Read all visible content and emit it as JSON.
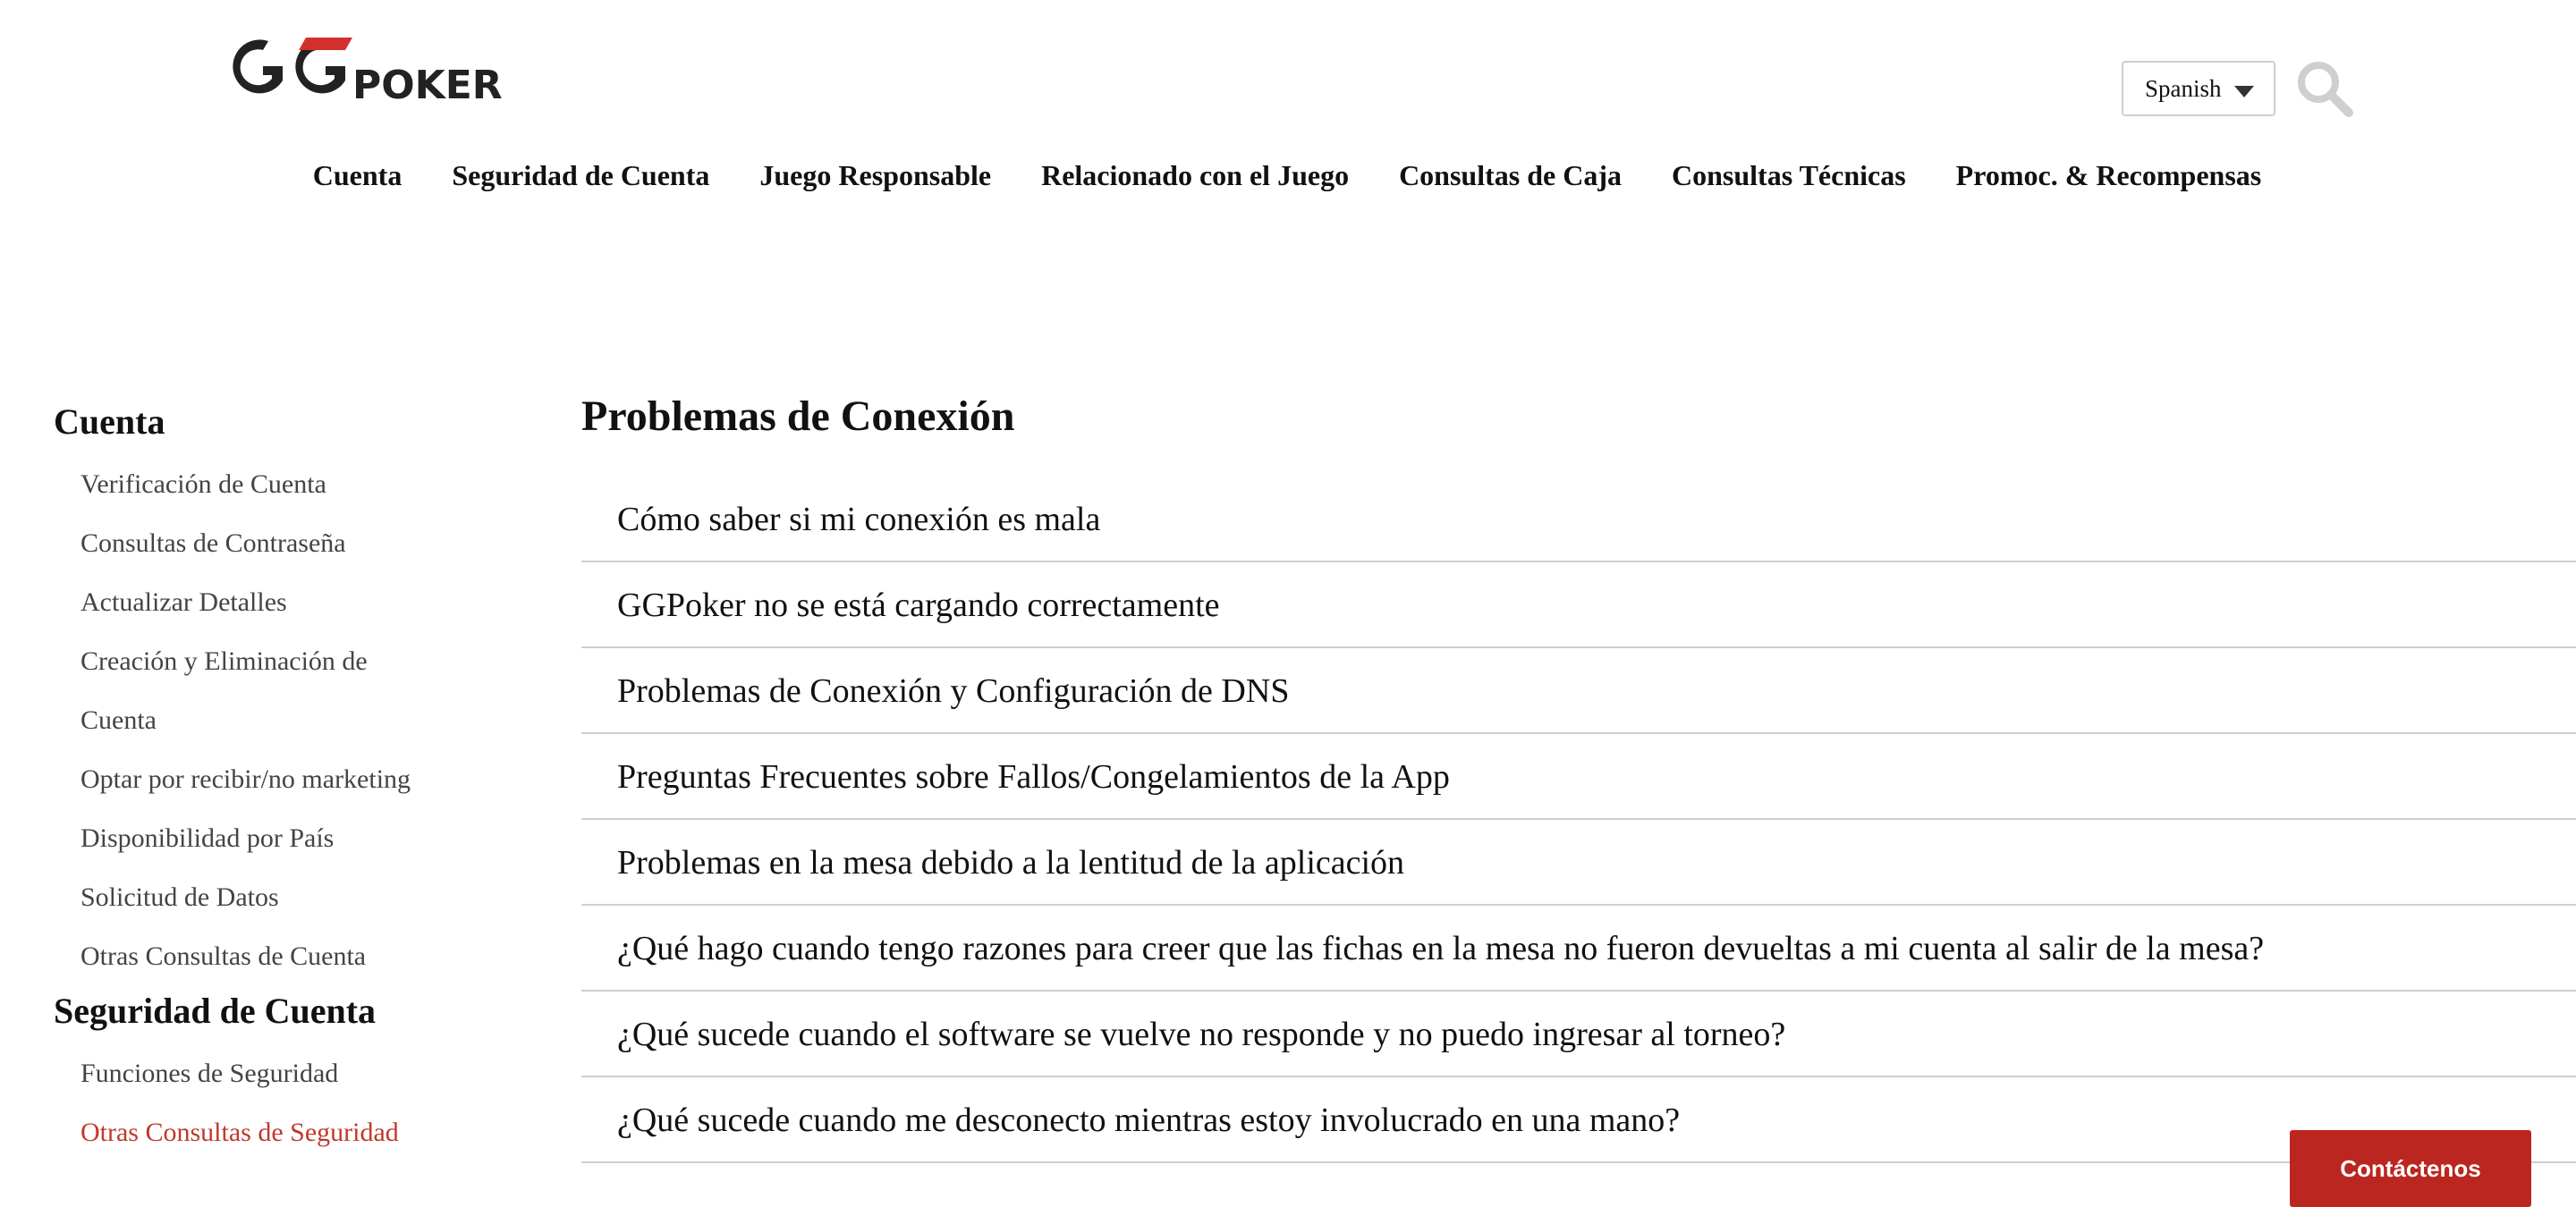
{
  "brand": {
    "logo_text": "GGPOKER",
    "logo_accent_color": "#d32f2f"
  },
  "header": {
    "language": {
      "selected": "Spanish"
    },
    "search_icon": "search-icon"
  },
  "nav": {
    "items": [
      {
        "label": "Cuenta"
      },
      {
        "label": "Seguridad de Cuenta"
      },
      {
        "label": "Juego Responsable"
      },
      {
        "label": "Relacionado con el Juego"
      },
      {
        "label": "Consultas de Caja"
      },
      {
        "label": "Consultas Técnicas"
      },
      {
        "label": "Promoc. & Recompensas"
      }
    ]
  },
  "sidebar": {
    "groups": [
      {
        "heading": "Cuenta",
        "items": [
          {
            "label": "Verificación de Cuenta"
          },
          {
            "label": "Consultas de Contraseña"
          },
          {
            "label": "Actualizar Detalles"
          },
          {
            "label": "Creación y Eliminación de"
          },
          {
            "label": "Cuenta"
          },
          {
            "label": "Optar por recibir/no marketing"
          },
          {
            "label": "Disponibilidad por País"
          },
          {
            "label": "Solicitud de Datos"
          },
          {
            "label": "Otras Consultas de Cuenta"
          }
        ]
      },
      {
        "heading": "Seguridad de Cuenta",
        "items": [
          {
            "label": "Funciones de Seguridad"
          },
          {
            "label": "Otras Consultas de Seguridad",
            "active": true
          }
        ]
      }
    ],
    "active_color": "#c0392b"
  },
  "main": {
    "title": "Problemas de Conexión",
    "articles": [
      {
        "label": "Cómo saber si mi conexión es mala"
      },
      {
        "label": "GGPoker no se está cargando correctamente"
      },
      {
        "label": "Problemas de Conexión y Configuración de DNS"
      },
      {
        "label": "Preguntas Frecuentes sobre Fallos/Congelamientos de la App"
      },
      {
        "label": "Problemas en la mesa debido a la lentitud de la aplicación"
      },
      {
        "label": "¿Qué hago cuando tengo razones para creer que las fichas en la mesa no fueron devueltas a mi cuenta al salir de la mesa?"
      },
      {
        "label": "¿Qué sucede cuando el software se vuelve no responde y no puedo ingresar al torneo?"
      },
      {
        "label": "¿Qué sucede cuando me desconecto mientras estoy involucrado en una mano?"
      }
    ]
  },
  "contact": {
    "label": "Contáctenos",
    "color": "#bb2620"
  }
}
